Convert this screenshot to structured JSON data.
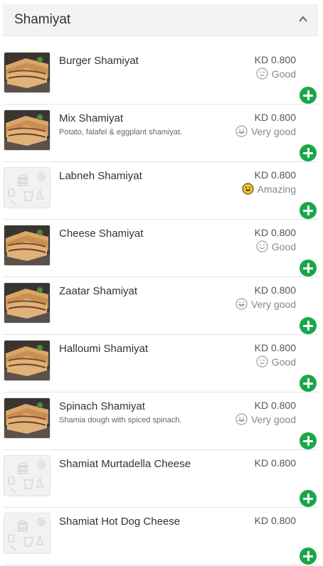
{
  "section": {
    "title": "Shamiyat"
  },
  "items": [
    {
      "name": "Burger Shamiyat",
      "description": "",
      "price": "KD 0.800",
      "rating": "Good",
      "rating_icon": "smile-outline-icon",
      "thumb": "photo"
    },
    {
      "name": "Mix Shamiyat",
      "description": "Potato, falafel & eggplant shamiyat.",
      "price": "KD 0.800",
      "rating": "Very good",
      "rating_icon": "grin-outline-icon",
      "thumb": "photo"
    },
    {
      "name": "Labneh Shamiyat",
      "description": "",
      "price": "KD 0.800",
      "rating": "Amazing",
      "rating_icon": "yellow-grin-icon",
      "thumb": "placeholder"
    },
    {
      "name": "Cheese Shamiyat",
      "description": "",
      "price": "KD 0.800",
      "rating": "Good",
      "rating_icon": "smile-outline-icon",
      "thumb": "photo"
    },
    {
      "name": "Zaatar Shamiyat",
      "description": "",
      "price": "KD 0.800",
      "rating": "Very good",
      "rating_icon": "grin-outline-icon",
      "thumb": "photo"
    },
    {
      "name": "Halloumi Shamiyat",
      "description": "",
      "price": "KD 0.800",
      "rating": "Good",
      "rating_icon": "smile-outline-icon",
      "thumb": "photo"
    },
    {
      "name": "Spinach Shamiyat",
      "description": "Shamia dough with spiced spinach.",
      "price": "KD 0.800",
      "rating": "Very good",
      "rating_icon": "grin-outline-icon",
      "thumb": "photo"
    },
    {
      "name": "Shamiat Murtadella Cheese",
      "description": "",
      "price": "KD 0.800",
      "rating": "",
      "rating_icon": "",
      "thumb": "placeholder"
    },
    {
      "name": "Shamiat Hot Dog Cheese",
      "description": "",
      "price": "KD 0.800",
      "rating": "",
      "rating_icon": "",
      "thumb": "placeholder"
    }
  ],
  "colors": {
    "accent": "#1aa64a",
    "header_bg": "#f3f3f3",
    "rating_gray": "#888888",
    "amazing_yellow": "#f5c518"
  }
}
